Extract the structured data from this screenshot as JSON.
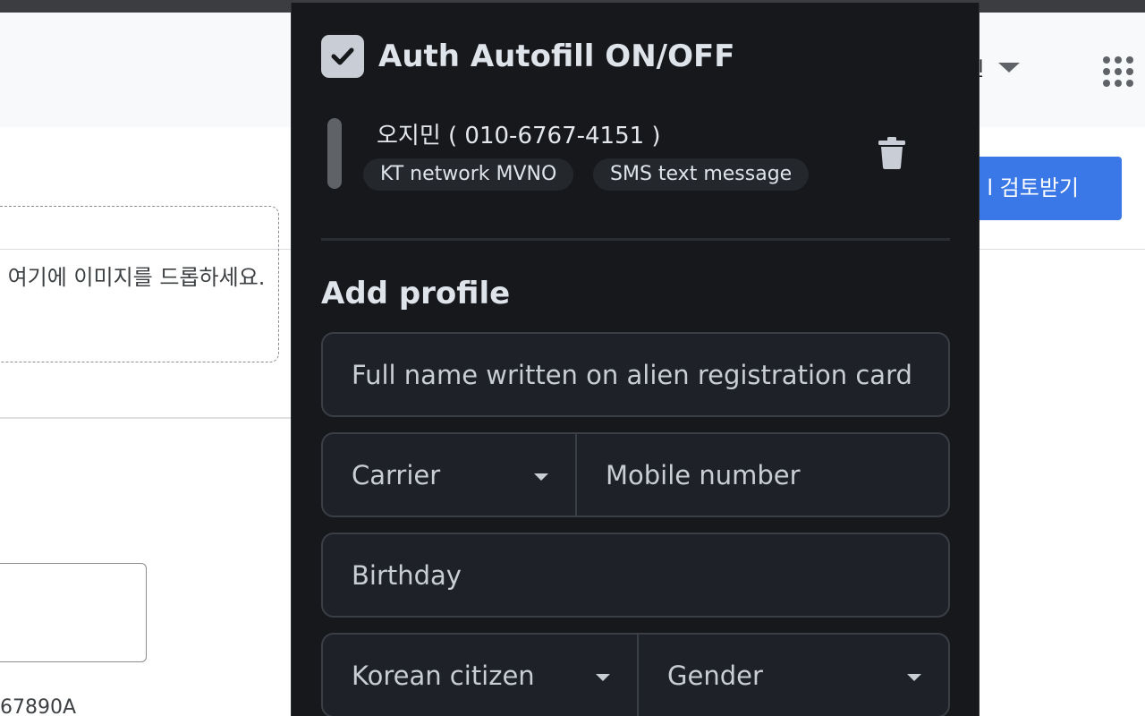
{
  "background": {
    "header_user_text": "민",
    "review_button_label": "l 검토받기",
    "drop_zone_text": "여기에 이미지를 드롭하세요.",
    "partial_code": "67890A"
  },
  "popup": {
    "toggle_label": "Auth Autofill ON/OFF",
    "toggle_checked": true,
    "profile": {
      "display": "오지민 ( 010-6767-4151 )",
      "chips": [
        "KT network MVNO",
        "SMS text message"
      ]
    },
    "add_profile_title": "Add profile",
    "fields": {
      "name_placeholder": "Full name written on alien registration card",
      "carrier_placeholder": "Carrier",
      "mobile_placeholder": "Mobile number",
      "birthday_placeholder": "Birthday",
      "citizen_placeholder": "Korean citizen",
      "gender_placeholder": "Gender"
    }
  },
  "colors": {
    "popup_bg": "#16181c",
    "field_bg": "#1e2127",
    "accent_blue": "#3b78e7"
  },
  "icons": [
    "check-icon",
    "trash-icon",
    "chevron-down-icon",
    "apps-grid-icon"
  ]
}
